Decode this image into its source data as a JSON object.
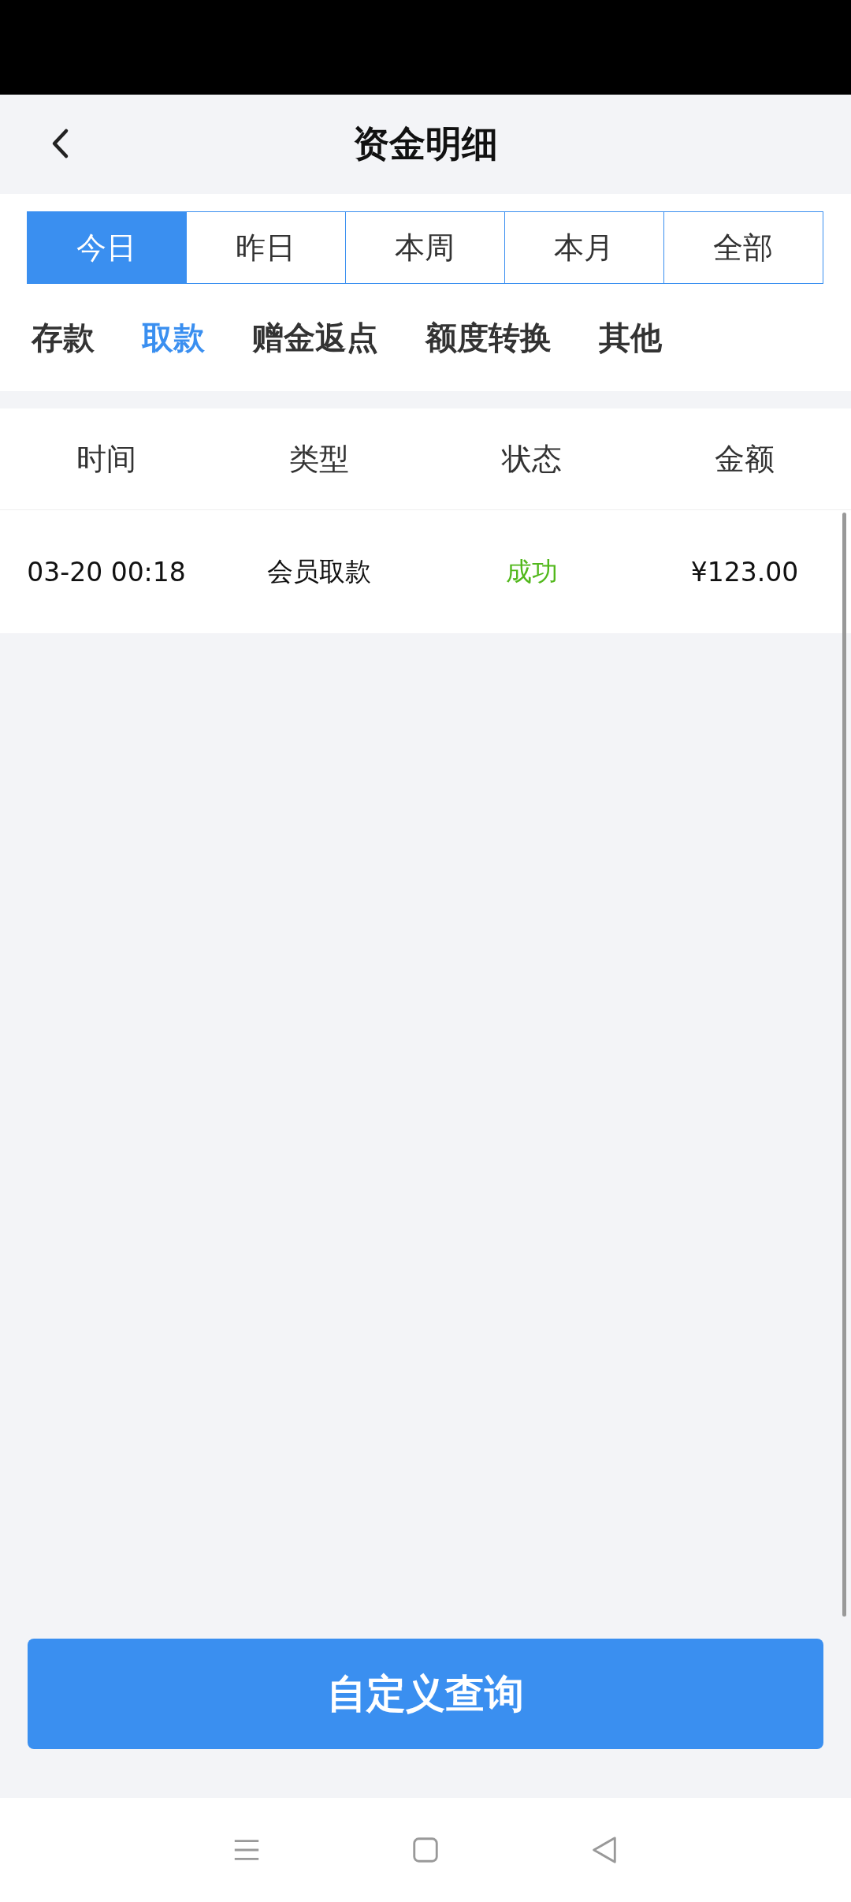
{
  "header": {
    "title": "资金明细"
  },
  "period_tabs": [
    {
      "label": "今日",
      "selected": true
    },
    {
      "label": "昨日",
      "selected": false
    },
    {
      "label": "本周",
      "selected": false
    },
    {
      "label": "本月",
      "selected": false
    },
    {
      "label": "全部",
      "selected": false
    }
  ],
  "category_tabs": [
    {
      "label": "存款",
      "selected": false
    },
    {
      "label": "取款",
      "selected": true
    },
    {
      "label": "赠金返点",
      "selected": false
    },
    {
      "label": "额度转换",
      "selected": false
    },
    {
      "label": "其他",
      "selected": false
    }
  ],
  "table": {
    "columns": [
      "时间",
      "类型",
      "状态",
      "金额"
    ],
    "rows": [
      {
        "time": "03-20 00:18",
        "type": "会员取款",
        "status": "成功",
        "color": "#52b81c",
        "amount": "¥123.00"
      }
    ]
  },
  "query_button": "自定义查询"
}
